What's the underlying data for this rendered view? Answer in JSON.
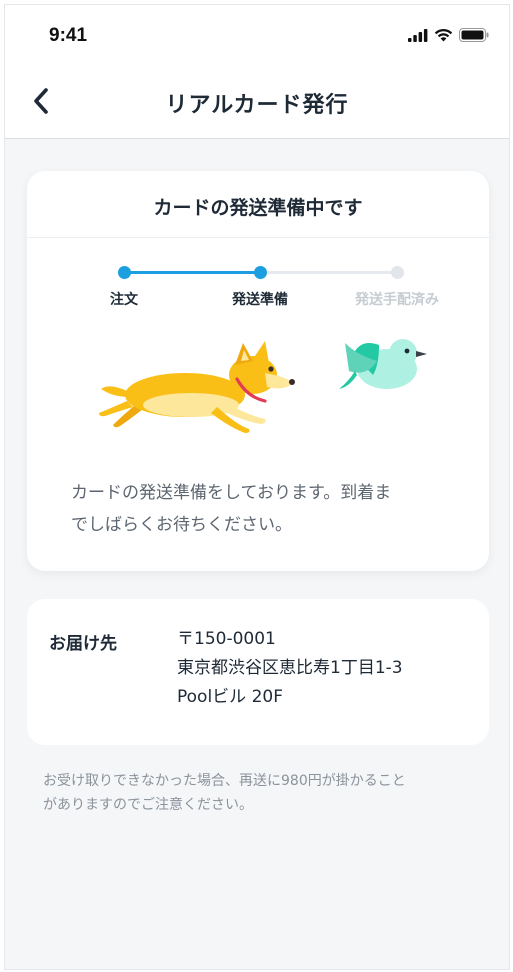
{
  "status_bar": {
    "time": "9:41"
  },
  "header": {
    "title": "リアルカード発行"
  },
  "status_card": {
    "title": "カードの発送準備中です",
    "steps": [
      {
        "label": "注文",
        "state": "done"
      },
      {
        "label": "発送準備",
        "state": "current"
      },
      {
        "label": "発送手配済み",
        "state": "pending"
      }
    ],
    "message_line1": "カードの発送準備をしております。到着ま",
    "message_line2": "でしばらくお待ちください。"
  },
  "address": {
    "label": "お届け先",
    "postal": "〒150-0001",
    "line1": "東京都渋谷区恵比寿1丁目1-3",
    "line2": "Poolビル 20F"
  },
  "notice": {
    "line1": "お受け取りできなかった場合、再送に980円が掛かること",
    "line2": "がありますのでご注意ください。"
  },
  "colors": {
    "accent": "#1c9fe0",
    "background": "#f4f6f8",
    "dog": "#f9bf17",
    "bird": "#5fd3b8"
  }
}
